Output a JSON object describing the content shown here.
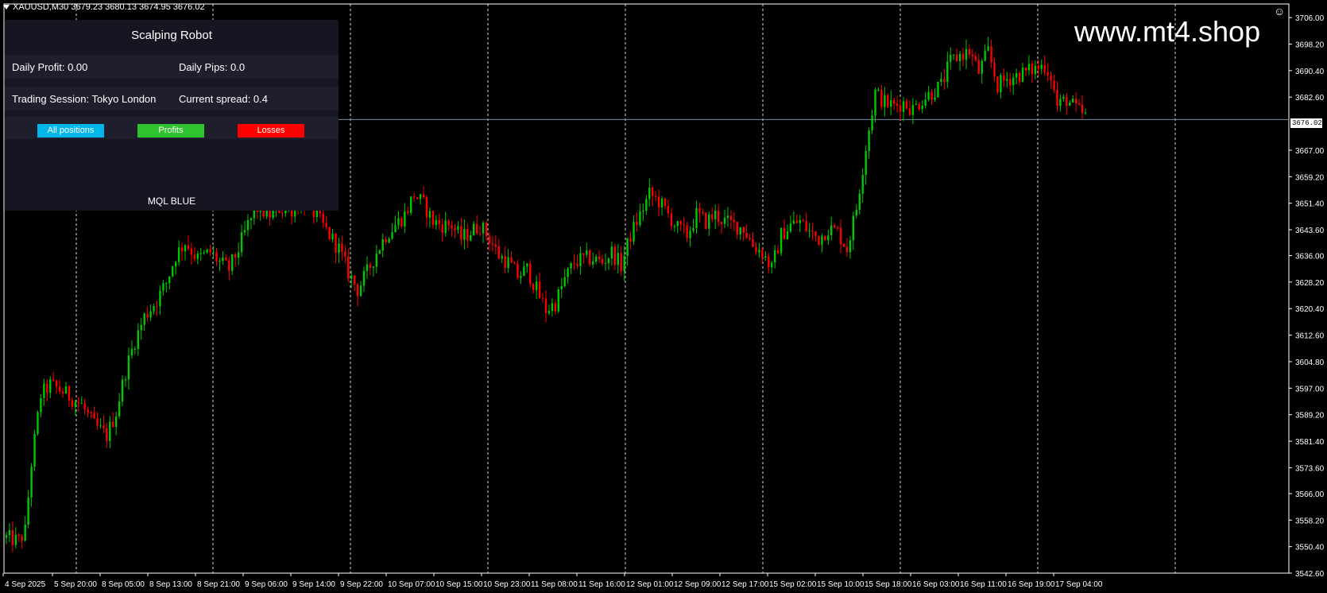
{
  "symbol_header": "XAUUSD,M30  3679.23 3680.13 3674.95 3676.02",
  "watermark": "www.mt4.shop",
  "panel": {
    "title": "Scalping Robot",
    "daily_profit": "Daily Profit: 0.00",
    "daily_pips": "Daily Pips:  0.0",
    "trading_session": "Trading Session: Tokyo London",
    "current_spread": "Current spread: 0.4",
    "buttons": [
      {
        "label": "All positions",
        "color": "#00b7eb"
      },
      {
        "label": "Profits",
        "color": "#2fc42f"
      },
      {
        "label": "Losses",
        "color": "#ff0000"
      }
    ],
    "footer": "MQL BLUE"
  },
  "current_price_label": "3676.02",
  "colors": {
    "background": "#000000",
    "bull_candle": "#00c800",
    "bear_candle": "#ff0000",
    "grid": "#ffffff",
    "axis": "#ffffff",
    "price_line": "#6f8fa6"
  },
  "chart_data": {
    "type": "candlestick",
    "symbol": "XAUUSD",
    "timeframe": "M30",
    "ylim": [
      3542.6,
      3710
    ],
    "y_ticks": [
      "3706.00",
      "3698.20",
      "3690.40",
      "3682.60",
      "3667.00",
      "3659.20",
      "3651.40",
      "3643.60",
      "3636.00",
      "3628.20",
      "3620.40",
      "3612.60",
      "3604.80",
      "3597.00",
      "3589.20",
      "3581.40",
      "3573.60",
      "3566.00",
      "3558.20",
      "3550.40",
      "3542.60"
    ],
    "x_ticks": [
      "4 Sep 2025",
      "5 Sep 20:00",
      "8 Sep 05:00",
      "8 Sep 13:00",
      "8 Sep 21:00",
      "9 Sep 06:00",
      "9 Sep 14:00",
      "9 Sep 22:00",
      "10 Sep 07:00",
      "10 Sep 15:00",
      "10 Sep 23:00",
      "11 Sep 08:00",
      "11 Sep 16:00",
      "12 Sep 01:00",
      "12 Sep 09:00",
      "12 Sep 17:00",
      "15 Sep 02:00",
      "15 Sep 10:00",
      "15 Sep 18:00",
      "16 Sep 03:00",
      "16 Sep 11:00",
      "16 Sep 19:00",
      "17 Sep 04:00"
    ],
    "current_price": 3676.02,
    "path_points": [
      [
        0,
        3553
      ],
      [
        4,
        3552
      ],
      [
        6,
        3555
      ],
      [
        8,
        3575
      ],
      [
        11,
        3595
      ],
      [
        14,
        3598
      ],
      [
        18,
        3596
      ],
      [
        21,
        3594
      ],
      [
        24,
        3592
      ],
      [
        28,
        3586
      ],
      [
        32,
        3583
      ],
      [
        35,
        3590
      ],
      [
        38,
        3602
      ],
      [
        41,
        3611
      ],
      [
        44,
        3618
      ],
      [
        48,
        3623
      ],
      [
        51,
        3628
      ],
      [
        54,
        3636
      ],
      [
        57,
        3640
      ],
      [
        61,
        3635
      ],
      [
        65,
        3637
      ],
      [
        68,
        3634
      ],
      [
        71,
        3632
      ],
      [
        74,
        3638
      ],
      [
        77,
        3645
      ],
      [
        80,
        3650
      ],
      [
        84,
        3648
      ],
      [
        87,
        3650
      ],
      [
        90,
        3649
      ],
      [
        94,
        3652
      ],
      [
        97,
        3650
      ],
      [
        100,
        3646
      ],
      [
        103,
        3642
      ],
      [
        106,
        3638
      ],
      [
        109,
        3631
      ],
      [
        112,
        3626
      ],
      [
        115,
        3631
      ],
      [
        118,
        3637
      ],
      [
        121,
        3642
      ],
      [
        124,
        3645
      ],
      [
        127,
        3648
      ],
      [
        130,
        3654
      ],
      [
        133,
        3651
      ],
      [
        136,
        3646
      ],
      [
        139,
        3645
      ],
      [
        142,
        3645
      ],
      [
        145,
        3641
      ],
      [
        148,
        3643
      ],
      [
        151,
        3645
      ],
      [
        154,
        3641
      ],
      [
        157,
        3636
      ],
      [
        160,
        3634
      ],
      [
        163,
        3630
      ],
      [
        166,
        3632
      ],
      [
        169,
        3626
      ],
      [
        172,
        3620
      ],
      [
        175,
        3622
      ],
      [
        178,
        3629
      ],
      [
        181,
        3634
      ],
      [
        184,
        3635
      ],
      [
        187,
        3635
      ],
      [
        190,
        3634
      ],
      [
        193,
        3637
      ],
      [
        196,
        3633
      ],
      [
        199,
        3642
      ],
      [
        202,
        3648
      ],
      [
        205,
        3654
      ],
      [
        208,
        3652
      ],
      [
        211,
        3648
      ],
      [
        214,
        3644
      ],
      [
        217,
        3642
      ],
      [
        220,
        3648
      ],
      [
        223,
        3646
      ],
      [
        226,
        3648
      ],
      [
        229,
        3646
      ],
      [
        232,
        3645
      ],
      [
        235,
        3644
      ],
      [
        238,
        3639
      ],
      [
        241,
        3637
      ],
      [
        244,
        3632
      ],
      [
        247,
        3642
      ],
      [
        250,
        3645
      ],
      [
        253,
        3646
      ],
      [
        256,
        3643
      ],
      [
        259,
        3641
      ],
      [
        262,
        3644
      ],
      [
        265,
        3643
      ],
      [
        268,
        3638
      ],
      [
        271,
        3650
      ],
      [
        274,
        3668
      ],
      [
        277,
        3684
      ],
      [
        280,
        3681
      ],
      [
        283,
        3680
      ],
      [
        286,
        3681
      ],
      [
        289,
        3679
      ],
      [
        292,
        3682
      ],
      [
        295,
        3684
      ],
      [
        298,
        3686
      ],
      [
        301,
        3693
      ],
      [
        304,
        3695
      ],
      [
        307,
        3696
      ],
      [
        310,
        3690
      ],
      [
        313,
        3696
      ],
      [
        316,
        3686
      ],
      [
        319,
        3688
      ],
      [
        322,
        3689
      ],
      [
        325,
        3690
      ],
      [
        328,
        3691
      ],
      [
        331,
        3692
      ],
      [
        333,
        3689
      ],
      [
        335,
        3680
      ],
      [
        338,
        3682
      ],
      [
        341,
        3679
      ],
      [
        344,
        3677
      ]
    ]
  }
}
